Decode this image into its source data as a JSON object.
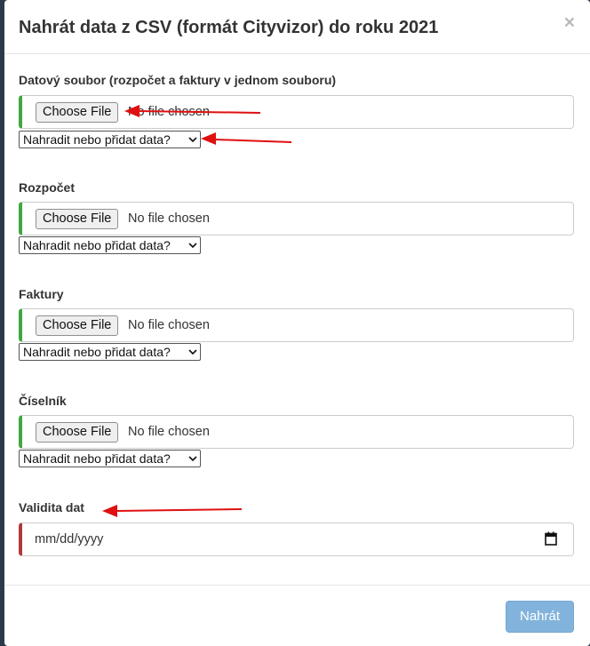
{
  "modal": {
    "title": "Nahrát data z CSV (formát Cityvizor) do roku 2021",
    "close_label": "×"
  },
  "fields": [
    {
      "label": "Datový soubor (rozpočet a faktury v jednom souboru)",
      "button_label": "Choose File",
      "file_status": "No file chosen",
      "select_value": "Nahradit nebo přidat data?"
    },
    {
      "label": "Rozpočet",
      "button_label": "Choose File",
      "file_status": "No file chosen",
      "select_value": "Nahradit nebo přidat data?"
    },
    {
      "label": "Faktury",
      "button_label": "Choose File",
      "file_status": "No file chosen",
      "select_value": "Nahradit nebo přidat data?"
    },
    {
      "label": "Číselník",
      "button_label": "Choose File",
      "file_status": "No file chosen",
      "select_value": "Nahradit nebo přidat data?"
    }
  ],
  "validity": {
    "label": "Validita dat",
    "placeholder": "mm/dd/yyyy"
  },
  "footer": {
    "submit_label": "Nahrát"
  },
  "colors": {
    "valid_border": "#3fa83f",
    "invalid_border": "#b03a3a",
    "submit_disabled": "#82b3dc",
    "annotation_arrow": "#e01010"
  },
  "icons": {
    "close": "close-icon",
    "select": "chevron-down-icon",
    "date": "calendar-icon",
    "annotation": "red-arrow-icon"
  }
}
